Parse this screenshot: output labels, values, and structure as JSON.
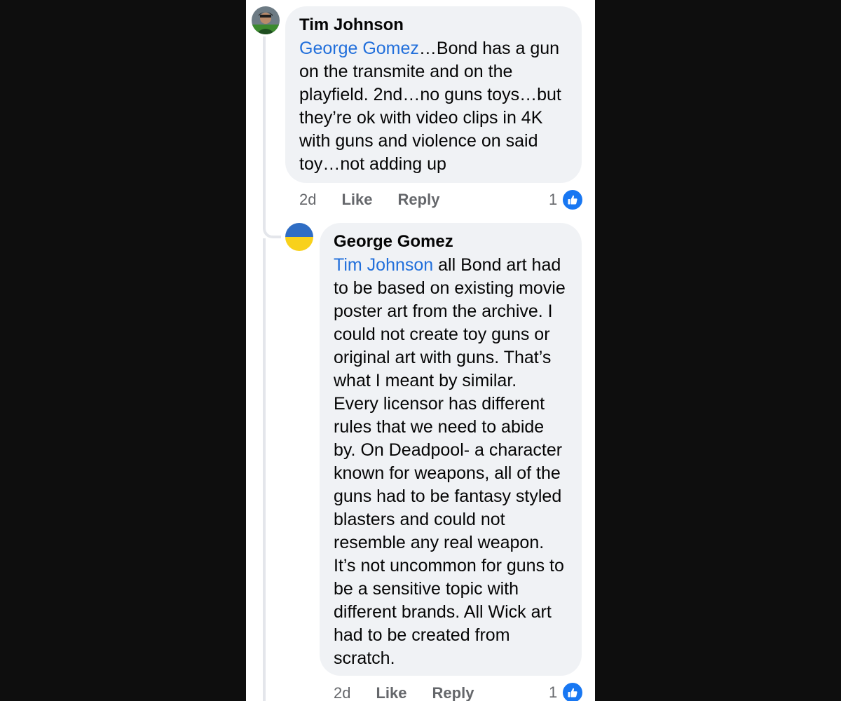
{
  "comments": [
    {
      "author": "Tim Johnson",
      "mention": "George Gomez",
      "body": "…Bond has a gun on the transmite and on the playfield. 2nd…no guns toys…but they’re ok with video clips in 4K with guns and violence on said toy…not adding up",
      "time": "2d",
      "like_label": "Like",
      "reply_label": "Reply",
      "reaction_count": "1",
      "reaction_icon": "thumbs-up-icon"
    },
    {
      "author": "George Gomez",
      "mention": "Tim Johnson",
      "body": " all Bond art had to be based on existing movie poster art from the archive. I could not create toy guns or original art with guns. That’s what I meant by similar. Every licensor has different rules that we need to abide by. On Deadpool- a character known for weapons, all of the guns had to be fantasy styled blasters and could not resemble any real weapon. It’s not uncommon for guns to be a sensitive topic with different brands. All Wick art had to be created from scratch.",
      "time": "2d",
      "like_label": "Like",
      "reply_label": "Reply",
      "reaction_count": "1",
      "reaction_icon": "thumbs-up-icon"
    }
  ],
  "colors": {
    "mention": "#216fdb",
    "bubble": "#f0f2f5",
    "like_badge": "#1877f2"
  }
}
